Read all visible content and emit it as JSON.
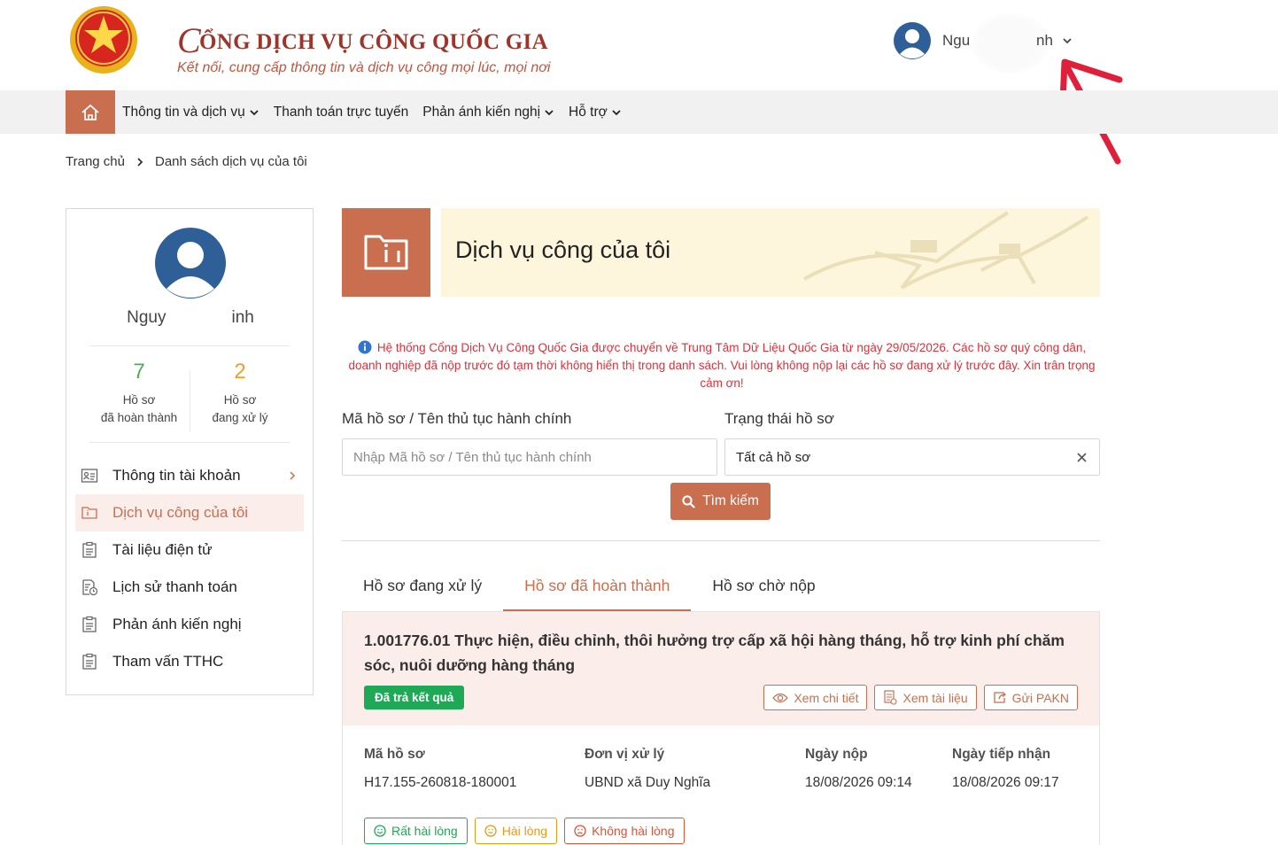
{
  "header": {
    "site_title_first": "C",
    "site_title_rest": "ỔNG DỊCH VỤ CÔNG QUỐC GIA",
    "site_subtitle": "Kết nối, cung cấp thông tin và dịch vụ công mọi lúc, mọi nơi",
    "user_name_prefix": "Ngu",
    "user_name_suffix": "nh"
  },
  "nav": {
    "items": [
      {
        "label": "Thông tin và dịch vụ",
        "dropdown": true
      },
      {
        "label": "Thanh toán trực tuyến",
        "dropdown": false
      },
      {
        "label": "Phản ánh kiến nghị",
        "dropdown": true
      },
      {
        "label": "Hỗ trợ",
        "dropdown": true
      }
    ]
  },
  "breadcrumb": {
    "home": "Trang chủ",
    "current": "Danh sách dịch vụ của tôi"
  },
  "sidebar": {
    "name_prefix": "Nguy",
    "name_suffix": "inh",
    "stats": {
      "done_count": "7",
      "done_label_1": "Hồ sơ",
      "done_label_2": "đã hoàn thành",
      "processing_count": "2",
      "processing_label_1": "Hồ sơ",
      "processing_label_2": "đang xử lý"
    },
    "menu": [
      {
        "label": "Thông tin tài khoản",
        "icon": "id-card-icon"
      },
      {
        "label": "Dịch vụ công của tôi",
        "icon": "folder-info-icon"
      },
      {
        "label": "Tài liệu điện tử",
        "icon": "document-icon"
      },
      {
        "label": "Lịch sử thanh toán",
        "icon": "payment-history-icon"
      },
      {
        "label": "Phản ánh kiến nghị",
        "icon": "feedback-icon"
      },
      {
        "label": "Tham vấn TTHC",
        "icon": "consult-icon"
      }
    ]
  },
  "main": {
    "banner_title": "Dịch vụ công của tôi",
    "notice": "Hệ thống Cổng Dịch Vụ Công Quốc Gia được chuyển về Trung Tâm Dữ Liệu Quốc Gia từ ngày 29/05/2026. Các hồ sơ quý công dân, doanh nghiệp đã nộp trước đó tạm thời không hiển thị trong danh sách. Vui lòng không nộp lại các hồ sơ đang xử lý trước đây. Xin trân trọng cảm ơn!",
    "search": {
      "code_label": "Mã hồ sơ / Tên thủ tục hành chính",
      "code_placeholder": "Nhập Mã hồ sơ / Tên thủ tục hành chính",
      "status_label": "Trạng thái hồ sơ",
      "status_value": "Tất cả hồ sơ",
      "button": "Tìm kiếm"
    },
    "tabs": [
      "Hồ sơ đang xử lý",
      "Hồ sơ đã hoàn thành",
      "Hồ sơ chờ nộp"
    ],
    "record": {
      "title": "1.001776.01 Thực hiện, điều chỉnh, thôi hưởng trợ cấp xã hội hàng tháng, hỗ trợ kinh phí chăm sóc, nuôi dưỡng hàng tháng",
      "status_badge": "Đã trả kết quả",
      "actions": [
        "Xem chi tiết",
        "Xem tài liệu",
        "Gửi PAKN"
      ],
      "fields": [
        {
          "label": "Mã hồ sơ",
          "value": "H17.155-260818-180001"
        },
        {
          "label": "Đơn vị xử lý",
          "value": "UBND xã Duy Nghĩa"
        },
        {
          "label": "Ngày nộp",
          "value": "18/08/2026 09:14"
        },
        {
          "label": "Ngày tiếp nhận",
          "value": "18/08/2026 09:17"
        }
      ],
      "ratings": [
        "Rất hài lòng",
        "Hài lòng",
        "Không hài lòng"
      ]
    }
  },
  "colors": {
    "brand": "#c96f4f",
    "title_red": "#a0342b",
    "notice_red": "#d8323c",
    "success_green": "#1fa855",
    "banner_bg": "#fdf6dc",
    "annotation_arrow": "#e0203a"
  }
}
